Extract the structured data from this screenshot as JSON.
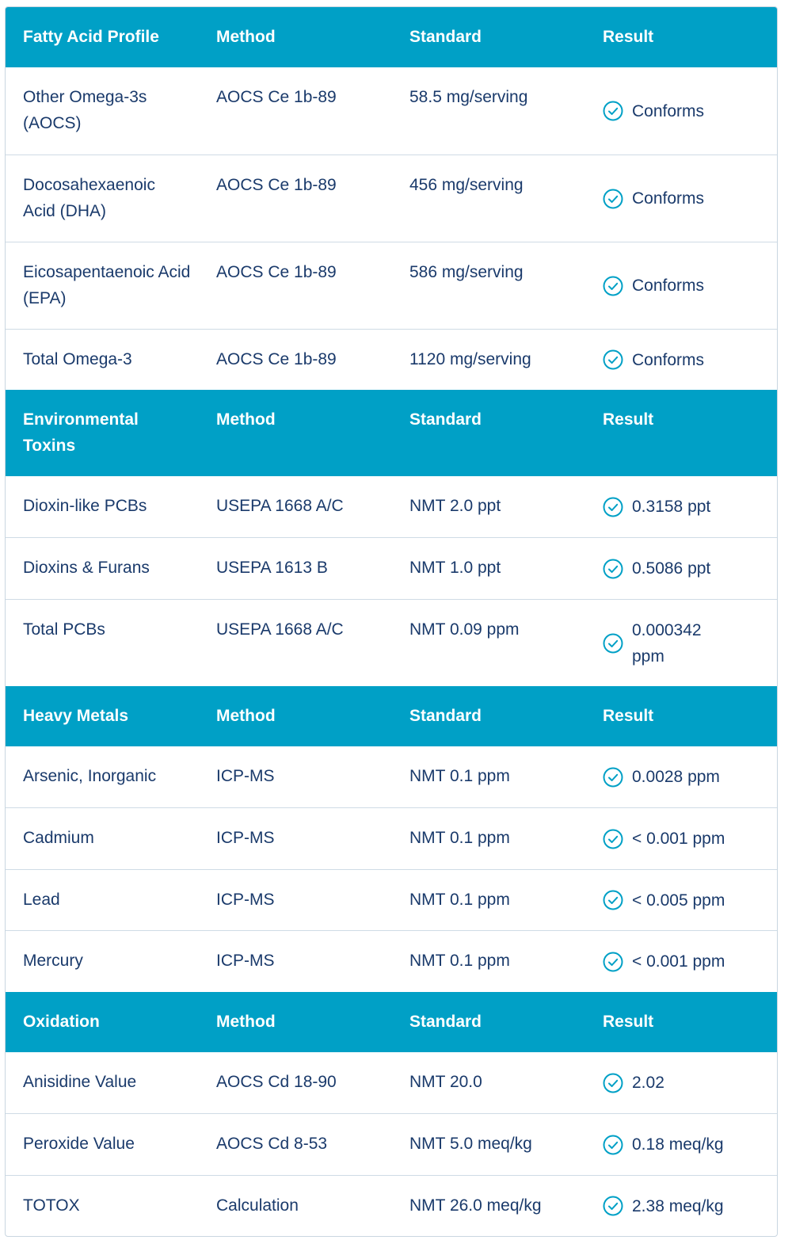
{
  "colors": {
    "header_bg": "#00a0c6",
    "text": "#1a3a6b",
    "check": "#00a0c6"
  },
  "icons": {
    "result": "check-circle-icon"
  },
  "sections": [
    {
      "header": {
        "title": "Fatty Acid Profile",
        "method": "Method",
        "standard": "Standard",
        "result": "Result"
      },
      "rows": [
        {
          "name": "Other Omega-3s (AOCS)",
          "method": "AOCS Ce 1b-89",
          "standard": "58.5 mg/serving",
          "result": "Conforms"
        },
        {
          "name": "Docosahexaenoic Acid (DHA)",
          "method": "AOCS Ce 1b-89",
          "standard": "456 mg/serving",
          "result": "Conforms"
        },
        {
          "name": "Eicosapentaenoic Acid (EPA)",
          "method": "AOCS Ce 1b-89",
          "standard": "586 mg/serving",
          "result": "Conforms"
        },
        {
          "name": "Total Omega-3",
          "method": "AOCS Ce 1b-89",
          "standard": "1120 mg/serving",
          "result": "Conforms"
        }
      ]
    },
    {
      "header": {
        "title": "Environmental Toxins",
        "method": "Method",
        "standard": "Standard",
        "result": "Result"
      },
      "rows": [
        {
          "name": "Dioxin-like PCBs",
          "method": "USEPA 1668 A/C",
          "standard": "NMT 2.0 ppt",
          "result": "0.3158 ppt"
        },
        {
          "name": "Dioxins & Furans",
          "method": "USEPA 1613 B",
          "standard": "NMT 1.0 ppt",
          "result": "0.5086 ppt"
        },
        {
          "name": "Total PCBs",
          "method": "USEPA 1668 A/C",
          "standard": "NMT 0.09 ppm",
          "result": "0.000342 ppm"
        }
      ]
    },
    {
      "header": {
        "title": "Heavy Metals",
        "method": "Method",
        "standard": "Standard",
        "result": "Result"
      },
      "rows": [
        {
          "name": "Arsenic, Inorganic",
          "method": "ICP-MS",
          "standard": "NMT 0.1 ppm",
          "result": "0.0028 ppm"
        },
        {
          "name": "Cadmium",
          "method": "ICP-MS",
          "standard": "NMT 0.1 ppm",
          "result": "< 0.001 ppm"
        },
        {
          "name": "Lead",
          "method": "ICP-MS",
          "standard": "NMT 0.1 ppm",
          "result": "< 0.005 ppm"
        },
        {
          "name": "Mercury",
          "method": "ICP-MS",
          "standard": "NMT 0.1 ppm",
          "result": "< 0.001 ppm"
        }
      ]
    },
    {
      "header": {
        "title": "Oxidation",
        "method": "Method",
        "standard": "Standard",
        "result": "Result"
      },
      "rows": [
        {
          "name": "Anisidine Value",
          "method": "AOCS Cd 18-90",
          "standard": "NMT 20.0",
          "result": "2.02"
        },
        {
          "name": "Peroxide Value",
          "method": "AOCS Cd 8-53",
          "standard": "NMT 5.0 meq/kg",
          "result": "0.18 meq/kg"
        },
        {
          "name": "TOTOX",
          "method": "Calculation",
          "standard": "NMT 26.0 meq/kg",
          "result": "2.38 meq/kg"
        }
      ]
    }
  ]
}
